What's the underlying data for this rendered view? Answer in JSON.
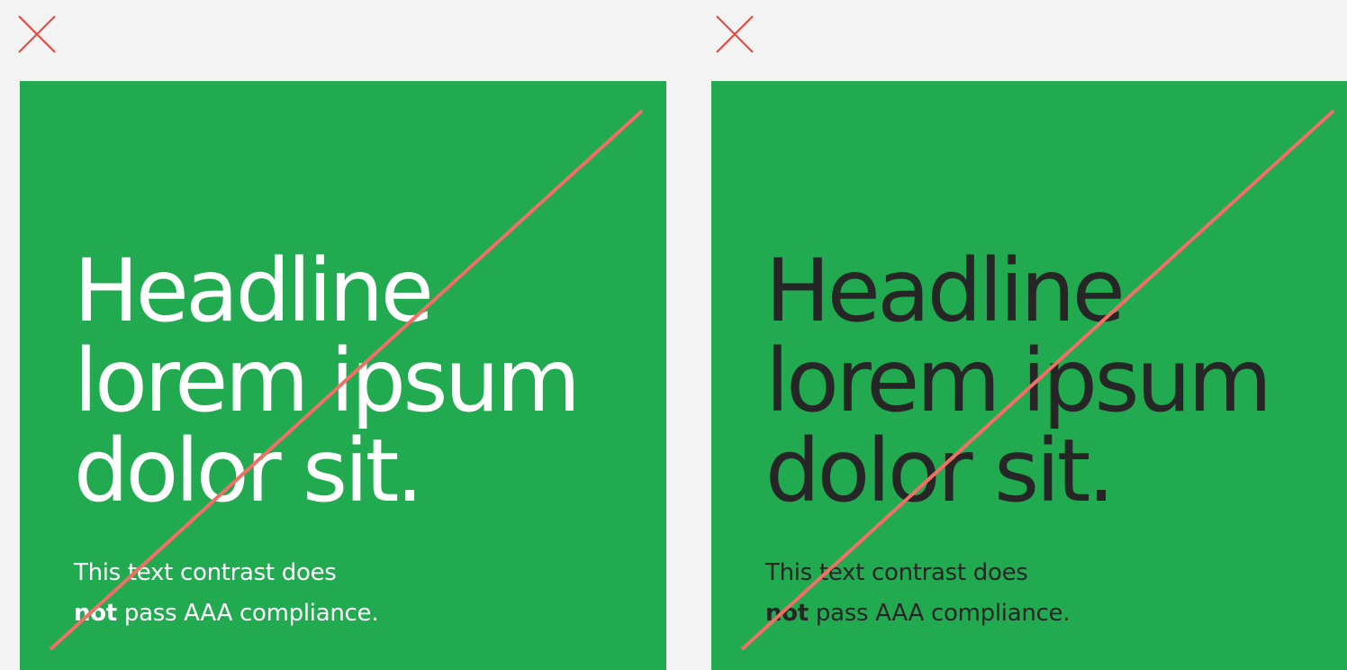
{
  "colors": {
    "page_background": "#f3f3f3",
    "card_background": "#21aa50",
    "mark": "#e5473b",
    "strike_line": "#f07066",
    "text_light": "#ffffff",
    "text_dark": "#262626"
  },
  "examples": [
    {
      "verdict_icon": "cross-icon",
      "text_color": "#ffffff",
      "headline": [
        "Headline",
        "lorem ipsum",
        "dolor sit."
      ],
      "body_line1": "This text contrast does",
      "body_emphasis": "not",
      "body_line2_rest": " pass AAA compliance."
    },
    {
      "verdict_icon": "cross-icon",
      "text_color": "#262626",
      "headline": [
        "Headline",
        "lorem ipsum",
        "dolor sit."
      ],
      "body_line1": "This text contrast does",
      "body_emphasis": "not",
      "body_line2_rest": " pass AAA compliance."
    }
  ]
}
